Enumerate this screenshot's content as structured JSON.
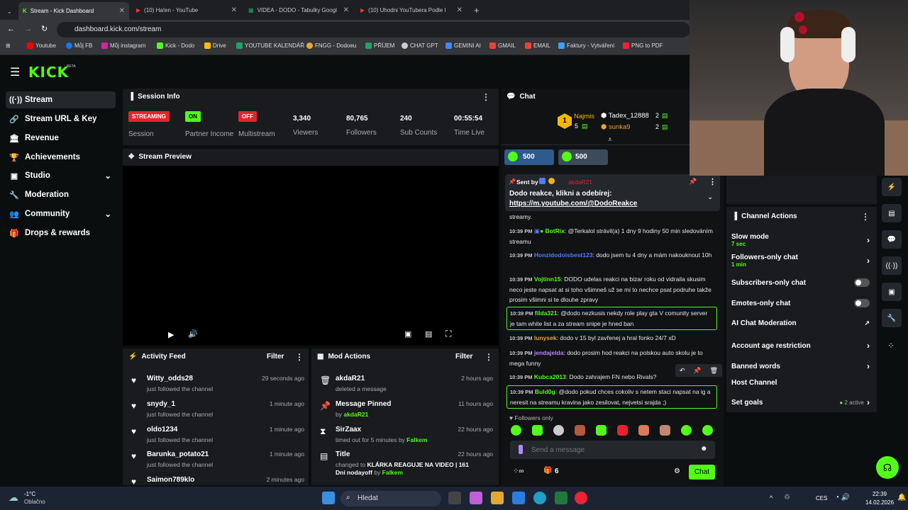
{
  "browser": {
    "tabs": [
      {
        "label": "Stream - Kick Dashboard",
        "icon": "kick-icon"
      },
      {
        "label": "(10) Ha!en - YouTube",
        "icon": "youtube-icon"
      },
      {
        "label": "VIDEA - DODO - Tabulky Googl",
        "icon": "sheets-icon"
      },
      {
        "label": "(10) Uhodni YouTubera Podle I",
        "icon": "youtube-icon"
      }
    ],
    "url": "dashboard.kick.com/stream",
    "bookmarks": [
      "Youtube",
      "Můj FB",
      "Můj instagram",
      "Kick - Dodo",
      "Drive",
      "YOUTUBE KALENDÁŘ",
      "FNGG - Dodoeu",
      "PŘÍJEM",
      "CHAT GPT",
      "GEMINI AI",
      "GMAIL",
      "EMAIL",
      "Faktury - Vytváření",
      "PNG to PDF"
    ]
  },
  "header": {
    "logo": "KICK",
    "logo_tag": "BETA"
  },
  "sidebar": {
    "items": [
      {
        "label": "Stream",
        "icon": "wifi-icon"
      },
      {
        "label": "Stream URL & Key",
        "icon": "link-icon"
      },
      {
        "label": "Revenue",
        "icon": "bank-icon"
      },
      {
        "label": "Achievements",
        "icon": "trophy-icon"
      },
      {
        "label": "Studio",
        "icon": "studio-icon"
      },
      {
        "label": "Moderation",
        "icon": "wrench-icon"
      },
      {
        "label": "Community",
        "icon": "people-icon"
      },
      {
        "label": "Drops & rewards",
        "icon": "gift-icon"
      }
    ]
  },
  "session": {
    "title": "Session Info",
    "streaming_badge": "STREAMING",
    "session_label": "Session",
    "partner_badge": "ON",
    "partner_label": "Partner Income",
    "multistream_badge": "OFF",
    "multistream_label": "Multistream",
    "viewers": "3,340",
    "viewers_label": "Viewers",
    "followers": "80,765",
    "followers_label": "Followers",
    "subs": "240",
    "subs_label": "Sub Counts",
    "time": "00:55:54",
    "time_label": "Time Live"
  },
  "preview": {
    "title": "Stream Preview"
  },
  "activity": {
    "title": "Activity Feed",
    "filter": "Filter",
    "items": [
      {
        "name": "Witty_odds28",
        "sub": "just followed the channel",
        "time": "29 seconds ago"
      },
      {
        "name": "snydy_1",
        "sub": "just followed the channel",
        "time": "1 minute ago"
      },
      {
        "name": "oldo1234",
        "sub": "just followed the channel",
        "time": "1 minute ago"
      },
      {
        "name": "Barunka_potato21",
        "sub": "just followed the channel",
        "time": "1 minute ago"
      },
      {
        "name": "Saimon789klo",
        "sub": "",
        "time": "2 minutes ago"
      }
    ]
  },
  "mod": {
    "title": "Mod Actions",
    "filter": "Filter",
    "items": [
      {
        "name": "akdaR21",
        "sub": "deleted a message",
        "time": "2 hours ago"
      },
      {
        "name": "Message Pinned",
        "sub": "by ",
        "by": "akdaR21",
        "time": "11 hours ago"
      },
      {
        "name": "SirZaax",
        "sub": "timed out for 5 minutes by ",
        "by": "Falkem",
        "time": "22 hours ago"
      },
      {
        "name": "Title",
        "sub": "changed to ",
        "title_text": "KLÁRKA REAGUJE NA VIDEO | 161 Dní nodayoff",
        "by_label": " by ",
        "by": "Falkem",
        "time": "22 hours ago"
      }
    ]
  },
  "chat": {
    "title": "Chat",
    "top": [
      {
        "name": "Najmis",
        "count": "5"
      },
      {
        "name": "Tadex_12888",
        "count": "2"
      },
      {
        "name": "sunka9",
        "count": "2"
      }
    ],
    "rank": "1",
    "gifts": [
      "500",
      "500"
    ],
    "pinned": {
      "sent_by": "Sent by",
      "user": "akdaR21",
      "text": "Dodo reakce, klikni a odebírej:",
      "link": "https://m.youtube.com/@DodoReakce"
    },
    "messages": [
      {
        "time": "",
        "user": "",
        "text": "streamy."
      },
      {
        "time": "10:39 PM",
        "user": "BotRix",
        "color": "#53fc18",
        "text": ": @Terkalol strávil(a) 1 dny 9 hodiny 50 min sledováním streamu"
      },
      {
        "time": "10:39 PM",
        "user": "Honzidodoisbest123",
        "color": "#4f7df9",
        "text": ": dodo jsem tu 4 dny a mám nakouknout 10h"
      },
      {
        "time": "10:39 PM",
        "user": "Vojtinn15",
        "color": "#53fc18",
        "text": ": DODO udelas reakci na bizar roku od vidraila skusim neco jeste napsat at si toho všimneš už se mi to nechce psat podruhe takže prosim všimni si te dlouhe zpravy"
      },
      {
        "time": "10:39 PM",
        "user": "filda321",
        "color": "#53fc18",
        "text": ": @dodo nezkusis nekdy role play gta V comunity server je tam white list a za stream snipe je hned ban"
      },
      {
        "time": "10:39 PM",
        "user": "lunysek",
        "color": "#e8a33c",
        "text": ": dodo v 15 byl zavřenej a hral fonko 24/7 xD"
      },
      {
        "time": "10:39 PM",
        "user": "jendajelda",
        "color": "#b388ff",
        "text": ": dodo prosim hod reakci na polskou auto skolu je to mega funny"
      },
      {
        "time": "10:39 PM",
        "user": "Kubca2013",
        "color": "#53fc18",
        "text": ": Dodo zahrajem FN nebo Rivals?"
      },
      {
        "time": "10:39 PM",
        "user": "Buld0g",
        "color": "#53fc18",
        "text": ": @dodo pokud chces cokoliv s netem staci napsat na ig a neresit na streamu kravina jako zesilovat, nejvetsi srajda ;)"
      }
    ],
    "followers_only": "Followers only",
    "placeholder": "Send a message",
    "count": "6",
    "send": "Chat"
  },
  "actions": {
    "title": "Channel Actions",
    "slow": "Slow mode",
    "slow_sub": "7 sec",
    "followers": "Followers-only chat",
    "followers_sub": "1 min",
    "subs": "Subscribers-only chat",
    "emotes": "Emotes-only chat",
    "ai": "AI Chat Moderation",
    "age": "Account age restriction",
    "banned": "Banned words",
    "host": "Host Channel",
    "goals": "Set goals",
    "goals_active": "2 active"
  },
  "taskbar": {
    "temp": "-1°C",
    "weather": "Oblačno",
    "search": "Hledat",
    "lang": "CES",
    "time": "22:39",
    "date": "14.02.2026"
  }
}
